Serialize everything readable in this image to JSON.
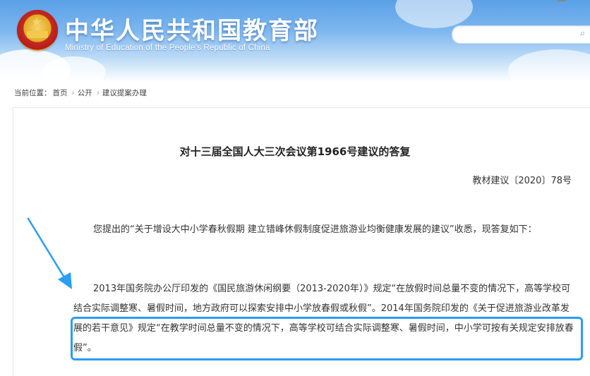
{
  "header": {
    "title_cn": "中华人民共和国教育部",
    "title_en": "Ministry of Education of the People's Republic of China",
    "search_placeholder": ""
  },
  "breadcrumb": {
    "prefix": "当前位置：",
    "items": [
      "首页",
      "公开",
      "建议提案办理"
    ],
    "separator": "›"
  },
  "document": {
    "title": "对十三届全国人大三次会议第1966号建议的答复",
    "reference": "教材建议〔2020〕78号",
    "paragraph1": "您提出的“关于增设大中小学春秋假期 建立错峰休假制度促进旅游业均衡健康发展的建议”收悉，现答复如下：",
    "paragraph2": "2013年国务院办公厅印发的《国民旅游休闲纲要（2013-2020年）》规定“在放假时间总量不变的情况下，高等学校可结合实际调整寒、暑假时间，地方政府可以探索安排中小学放春假或秋假”。2014年国务院印发的《关于促进旅游业改革发展的若干意见》规定“在教学时间总量不变的情况下，高等学校可结合实际调整寒、暑假时间，中小学可按有关规定安排放春假”。"
  },
  "colors": {
    "header_blue": "#5aa0e6",
    "highlight_border": "#2a9df4",
    "arrow": "#2a9df4"
  },
  "icons": {
    "emblem": "national-emblem-icon",
    "search": "search-icon",
    "arrow": "annotation-arrow-icon"
  }
}
